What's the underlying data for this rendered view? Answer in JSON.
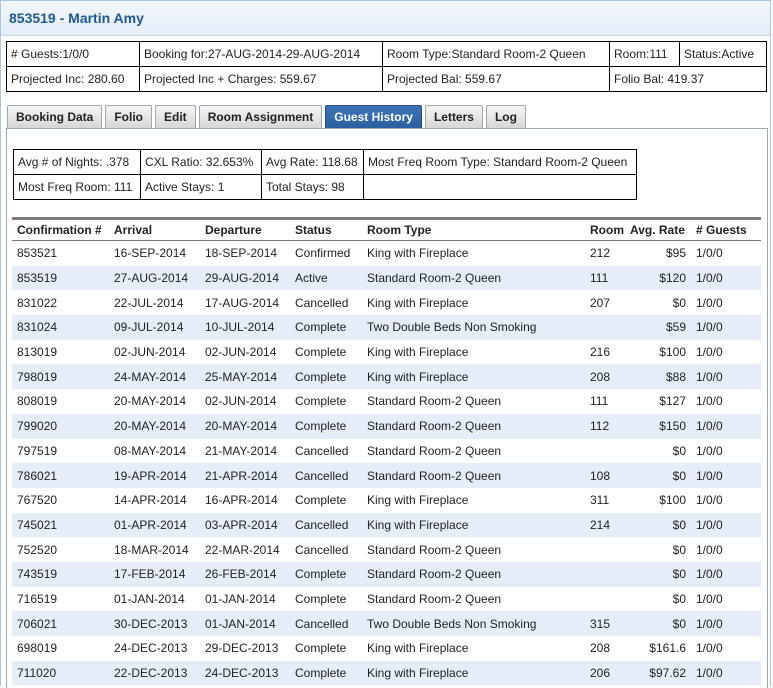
{
  "header": {
    "title": "853519 - Martin Amy"
  },
  "summary": {
    "row1": [
      "# Guests:1/0/0",
      "Booking for:27-AUG-2014-29-AUG-2014",
      "Room Type:Standard Room-2 Queen",
      "Room:111",
      "Status:Active"
    ],
    "row2": [
      "Projected Inc: 280.60",
      "Projected Inc + Charges: 559.67",
      "Projected Bal: 559.67",
      "Folio Bal: 419.37"
    ]
  },
  "tabs": [
    {
      "label": "Booking Data",
      "active": false
    },
    {
      "label": "Folio",
      "active": false
    },
    {
      "label": "Edit",
      "active": false
    },
    {
      "label": "Room Assignment",
      "active": false
    },
    {
      "label": "Guest History",
      "active": true
    },
    {
      "label": "Letters",
      "active": false
    },
    {
      "label": "Log",
      "active": false
    }
  ],
  "stats": {
    "row1": [
      "Avg # of Nights: .378",
      "CXL Ratio: 32.653%",
      "Avg Rate: 118.68",
      "Most Freq Room Type: Standard Room-2 Queen"
    ],
    "row2": [
      "Most Freq Room: 111",
      "Active Stays: 1",
      "Total Stays: 98",
      ""
    ]
  },
  "history": {
    "columns": [
      "Confirmation #",
      "Arrival",
      "Departure",
      "Status",
      "Room Type",
      "Room",
      "Avg. Rate",
      "# Guests"
    ],
    "rows": [
      [
        "853521",
        "16-SEP-2014",
        "18-SEP-2014",
        "Confirmed",
        "King with Fireplace",
        "212",
        "$95",
        "1/0/0"
      ],
      [
        "853519",
        "27-AUG-2014",
        "29-AUG-2014",
        "Active",
        "Standard Room-2 Queen",
        "111",
        "$120",
        "1/0/0"
      ],
      [
        "831022",
        "22-JUL-2014",
        "17-AUG-2014",
        "Cancelled",
        "King with Fireplace",
        "207",
        "$0",
        "1/0/0"
      ],
      [
        "831024",
        "09-JUL-2014",
        "10-JUL-2014",
        "Complete",
        "Two Double Beds Non Smoking",
        "",
        "$59",
        "1/0/0"
      ],
      [
        "813019",
        "02-JUN-2014",
        "02-JUN-2014",
        "Complete",
        "King with Fireplace",
        "216",
        "$100",
        "1/0/0"
      ],
      [
        "798019",
        "24-MAY-2014",
        "25-MAY-2014",
        "Complete",
        "King with Fireplace",
        "208",
        "$88",
        "1/0/0"
      ],
      [
        "808019",
        "20-MAY-2014",
        "02-JUN-2014",
        "Complete",
        "Standard Room-2 Queen",
        "111",
        "$127",
        "1/0/0"
      ],
      [
        "799020",
        "20-MAY-2014",
        "20-MAY-2014",
        "Complete",
        "Standard Room-2 Queen",
        "112",
        "$150",
        "1/0/0"
      ],
      [
        "797519",
        "08-MAY-2014",
        "21-MAY-2014",
        "Cancelled",
        "Standard Room-2 Queen",
        "",
        "$0",
        "1/0/0"
      ],
      [
        "786021",
        "19-APR-2014",
        "21-APR-2014",
        "Cancelled",
        "Standard Room-2 Queen",
        "108",
        "$0",
        "1/0/0"
      ],
      [
        "767520",
        "14-APR-2014",
        "16-APR-2014",
        "Complete",
        "King with Fireplace",
        "311",
        "$100",
        "1/0/0"
      ],
      [
        "745021",
        "01-APR-2014",
        "03-APR-2014",
        "Cancelled",
        "King with Fireplace",
        "214",
        "$0",
        "1/0/0"
      ],
      [
        "752520",
        "18-MAR-2014",
        "22-MAR-2014",
        "Cancelled",
        "Standard Room-2 Queen",
        "",
        "$0",
        "1/0/0"
      ],
      [
        "743519",
        "17-FEB-2014",
        "26-FEB-2014",
        "Complete",
        "Standard Room-2 Queen",
        "",
        "$0",
        "1/0/0"
      ],
      [
        "716519",
        "01-JAN-2014",
        "01-JAN-2014",
        "Complete",
        "Standard Room-2 Queen",
        "",
        "$0",
        "1/0/0"
      ],
      [
        "706021",
        "30-DEC-2013",
        "01-JAN-2014",
        "Cancelled",
        "Two Double Beds Non Smoking",
        "315",
        "$0",
        "1/0/0"
      ],
      [
        "698019",
        "24-DEC-2013",
        "29-DEC-2013",
        "Complete",
        "King with Fireplace",
        "208",
        "$161.6",
        "1/0/0"
      ],
      [
        "711020",
        "22-DEC-2013",
        "24-DEC-2013",
        "Complete",
        "King with Fireplace",
        "206",
        "$97.62",
        "1/0/0"
      ]
    ]
  }
}
